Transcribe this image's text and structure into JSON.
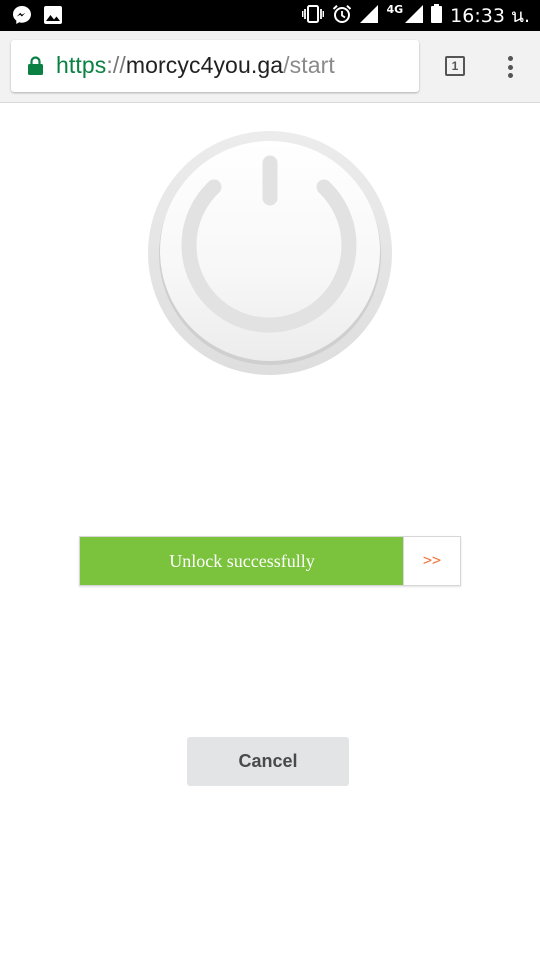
{
  "status_bar": {
    "left_icons": [
      "messenger-icon",
      "image-icon"
    ],
    "right_icons": [
      "vibrate-icon",
      "alarm-icon",
      "signal-icon",
      "signal-4g-icon",
      "battery-icon"
    ],
    "network": "4G",
    "time": "16:33 น."
  },
  "browser": {
    "url": {
      "scheme": "https",
      "separator": "://",
      "host": "morcyc4you.ga",
      "path": "/start"
    },
    "tab_count": "1"
  },
  "colors": {
    "progress_fill": "#7bc33d",
    "arrow": "#f07840",
    "url_scheme": "#0b8043"
  },
  "unlock": {
    "progress": 0.85,
    "label": "Unlock successfully",
    "arrow_label": ">>"
  },
  "cancel_label": "Cancel"
}
